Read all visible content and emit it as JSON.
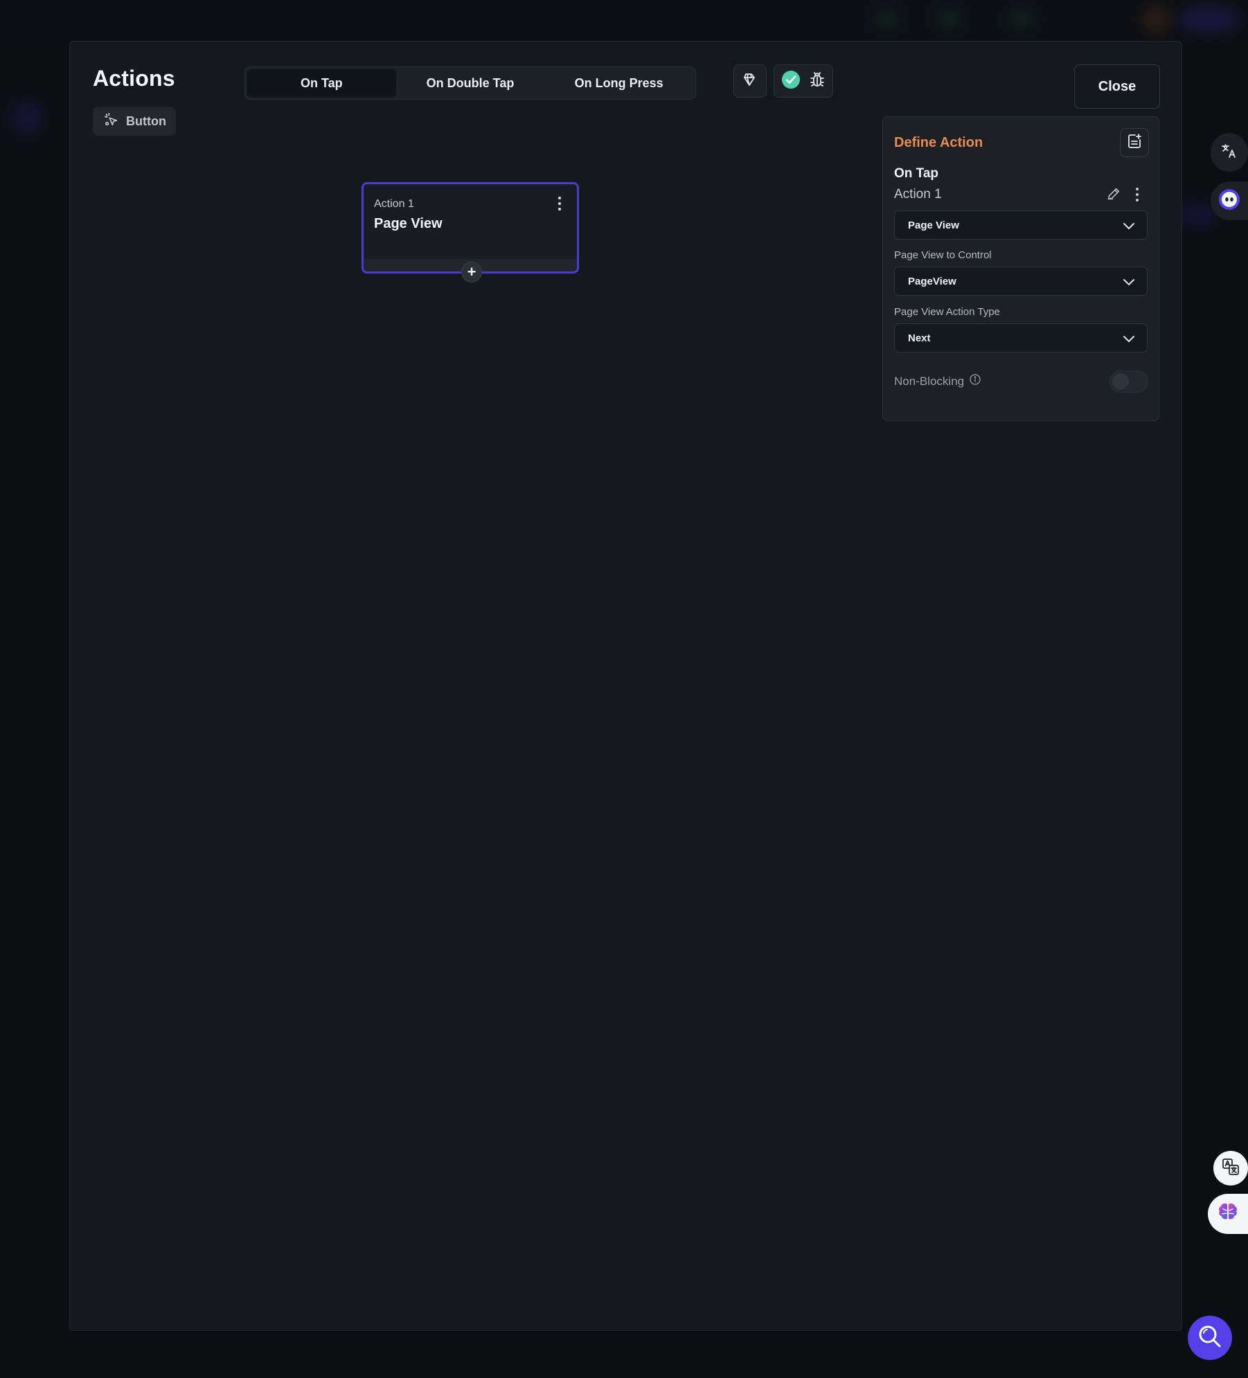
{
  "modal": {
    "title": "Actions",
    "widget_chip_label": "Button",
    "close_label": "Close"
  },
  "tabs": [
    {
      "label": "On Tap",
      "active": true
    },
    {
      "label": "On Double Tap",
      "active": false
    },
    {
      "label": "On Long Press",
      "active": false
    }
  ],
  "toolbar": {
    "icons": [
      "gem-cursor-icon",
      "check-circle-icon",
      "bug-icon"
    ],
    "check_color": "#4fd1b0"
  },
  "node": {
    "subtitle": "Action 1",
    "title": "Page View",
    "border_color": "#4b3bd6"
  },
  "panel": {
    "title": "Define Action",
    "title_color": "#e98a4e",
    "trigger": "On Tap",
    "action_name": "Action 1",
    "action_type_value": "Page View",
    "page_view_label": "Page View to Control",
    "page_view_value": "PageView",
    "action_type_label": "Page View Action Type",
    "action_type_select_value": "Next",
    "non_blocking_label": "Non-Blocking",
    "non_blocking_on": false
  },
  "floating": {
    "icons": [
      "translate-icon",
      "assistant-icon",
      "language-icon",
      "brain-icon",
      "search-icon"
    ],
    "accent": "#5340e8"
  }
}
